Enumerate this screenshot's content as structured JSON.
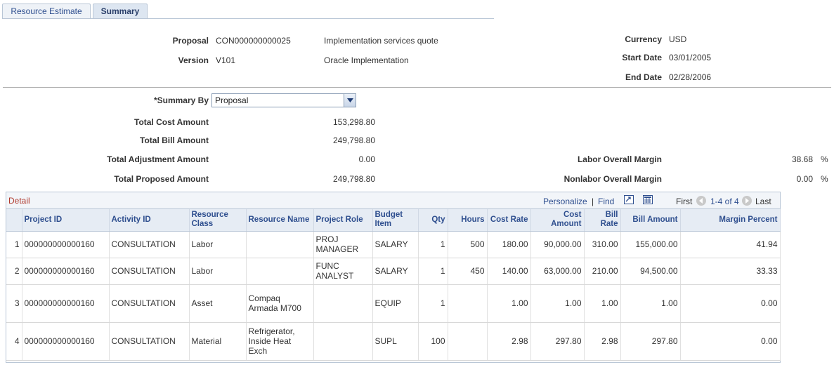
{
  "tabs": [
    {
      "label": "Resource Estimate",
      "active": false
    },
    {
      "label": "Summary",
      "active": true
    }
  ],
  "header": {
    "proposal_label": "Proposal",
    "proposal_value": "CON000000000025",
    "proposal_desc": "Implementation services quote",
    "version_label": "Version",
    "version_value": "V101",
    "version_desc": "Oracle Implementation",
    "currency_label": "Currency",
    "currency_value": "USD",
    "start_label": "Start Date",
    "start_value": "03/01/2005",
    "end_label": "End Date",
    "end_value": "02/28/2006"
  },
  "summary": {
    "summary_by_label": "*Summary By",
    "summary_by_value": "Proposal",
    "total_cost_label": "Total Cost Amount",
    "total_cost_value": "153,298.80",
    "total_bill_label": "Total Bill Amount",
    "total_bill_value": "249,798.80",
    "total_adj_label": "Total Adjustment Amount",
    "total_adj_value": "0.00",
    "total_prop_label": "Total Proposed Amount",
    "total_prop_value": "249,798.80",
    "labor_margin_label": "Labor Overall Margin",
    "labor_margin_value": "38.68",
    "nonlabor_margin_label": "Nonlabor Overall Margin",
    "nonlabor_margin_value": "0.00",
    "percent_sign": "%"
  },
  "grid": {
    "title": "Detail",
    "personalize": "Personalize",
    "separator": "|",
    "find": "Find",
    "first": "First",
    "range": "1-4 of 4",
    "last": "Last",
    "columns": [
      "Project ID",
      "Activity ID",
      "Resource Class",
      "Resource Name",
      "Project Role",
      "Budget Item",
      "Qty",
      "Hours",
      "Cost Rate",
      "Cost Amount",
      "Bill Rate",
      "Bill Amount",
      "Margin Percent"
    ],
    "rows": [
      {
        "num": "1",
        "project_id": "000000000000160",
        "activity_id": "CONSULTATION",
        "resource_class": "Labor",
        "resource_name": "",
        "project_role": "PROJ MANAGER",
        "budget_item": "SALARY",
        "qty": "1",
        "hours": "500",
        "cost_rate": "180.00",
        "cost_amount": "90,000.00",
        "bill_rate": "310.00",
        "bill_amount": "155,000.00",
        "margin_percent": "41.94"
      },
      {
        "num": "2",
        "project_id": "000000000000160",
        "activity_id": "CONSULTATION",
        "resource_class": "Labor",
        "resource_name": "",
        "project_role": "FUNC ANALYST",
        "budget_item": "SALARY",
        "qty": "1",
        "hours": "450",
        "cost_rate": "140.00",
        "cost_amount": "63,000.00",
        "bill_rate": "210.00",
        "bill_amount": "94,500.00",
        "margin_percent": "33.33"
      },
      {
        "num": "3",
        "project_id": "000000000000160",
        "activity_id": "CONSULTATION",
        "resource_class": "Asset",
        "resource_name": "Compaq Armada M700",
        "project_role": "",
        "budget_item": "EQUIP",
        "qty": "1",
        "hours": "",
        "cost_rate": "1.00",
        "cost_amount": "1.00",
        "bill_rate": "1.00",
        "bill_amount": "1.00",
        "margin_percent": "0.00"
      },
      {
        "num": "4",
        "project_id": "000000000000160",
        "activity_id": "CONSULTATION",
        "resource_class": "Material",
        "resource_name": "Refrigerator, Inside Heat Exch",
        "project_role": "",
        "budget_item": "SUPL",
        "qty": "100",
        "hours": "",
        "cost_rate": "2.98",
        "cost_amount": "297.80",
        "bill_rate": "2.98",
        "bill_amount": "297.80",
        "margin_percent": "0.00"
      }
    ]
  }
}
